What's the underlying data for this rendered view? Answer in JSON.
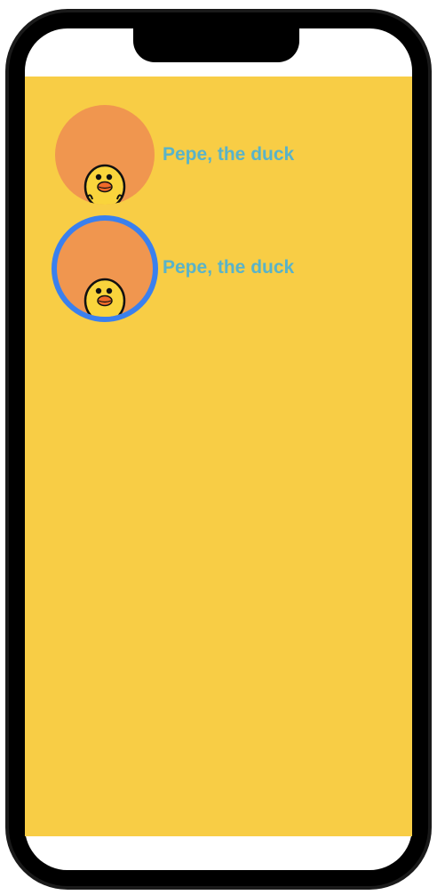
{
  "profiles": [
    {
      "name": "Pepe, the duck",
      "selected": false
    },
    {
      "name": "Pepe, the duck",
      "selected": true
    }
  ],
  "colors": {
    "background": "#f8cd45",
    "avatar_fill": "#f0964f",
    "selection_ring": "#3a80ee",
    "name_text": "#59b3c9"
  },
  "icons": {
    "avatar": "duck-icon"
  }
}
